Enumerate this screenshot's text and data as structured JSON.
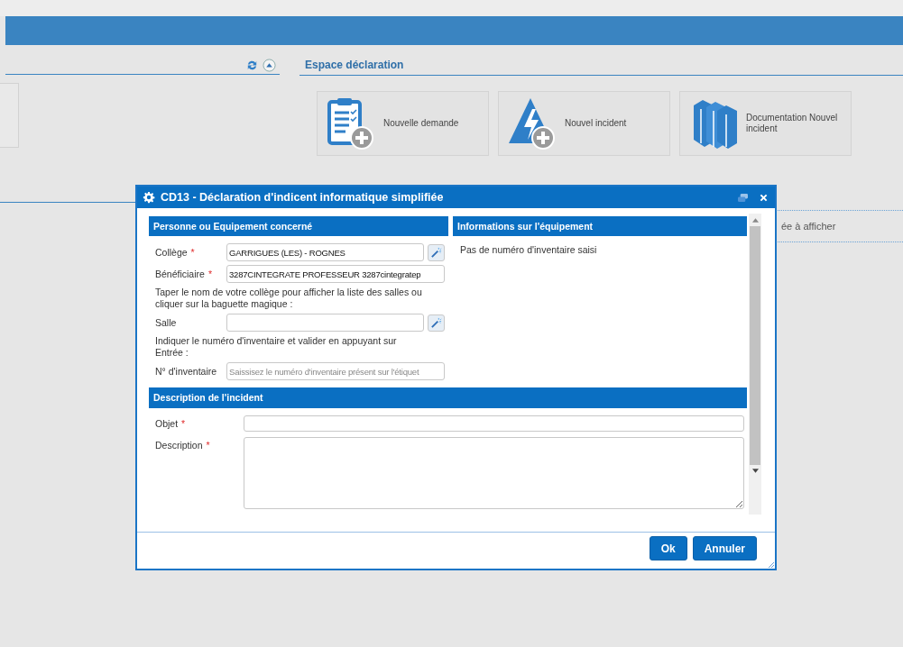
{
  "declaration_space": {
    "title": "Espace déclaration",
    "tiles": [
      {
        "label": "Nouvelle demande",
        "kind": "request"
      },
      {
        "label": "Nouvel incident",
        "kind": "incident"
      },
      {
        "label": "Documentation Nouvel incident",
        "kind": "documentation"
      }
    ]
  },
  "list_panel": {
    "message": "ée à afficher"
  },
  "dialog": {
    "title": "CD13 - Déclaration d'indicent informatique simplifiée",
    "person_section": {
      "title": "Personne ou Equipement concerné",
      "rows": [
        {
          "kind": "field",
          "label": "Collège",
          "required_mark": "*",
          "value": "GARRIGUES (LES) - ROGNES",
          "picker": true
        },
        {
          "kind": "field",
          "label": "Bénéficiaire",
          "required_mark": "*",
          "value": "3287CINTEGRATE PROFESSEUR 3287cintegratep",
          "picker": false
        },
        {
          "kind": "hint",
          "text": "Taper le nom de votre collège pour afficher la liste des salles ou cliquer sur la baguette magique :"
        },
        {
          "kind": "field",
          "label": "Salle",
          "picker": true
        },
        {
          "kind": "hint",
          "text": "Indiquer le numéro d'inventaire et valider en appuyant sur Entrée :"
        },
        {
          "kind": "field",
          "label": "N° d'inventaire",
          "placeholder": "Saissisez le numéro d'inventaire présent sur l'étiquet",
          "picker": false
        }
      ]
    },
    "equipment_section": {
      "title": "Informations sur l'équipement",
      "message": "Pas de numéro d'inventaire saisi"
    },
    "incident_section": {
      "title": "Description de l'incident",
      "fields": [
        {
          "kind": "line",
          "label": "Objet",
          "required_mark": "*"
        },
        {
          "kind": "area",
          "label": "Description",
          "required_mark": "*"
        }
      ]
    },
    "buttons": [
      {
        "label": "Ok"
      },
      {
        "label": "Annuler"
      }
    ]
  }
}
